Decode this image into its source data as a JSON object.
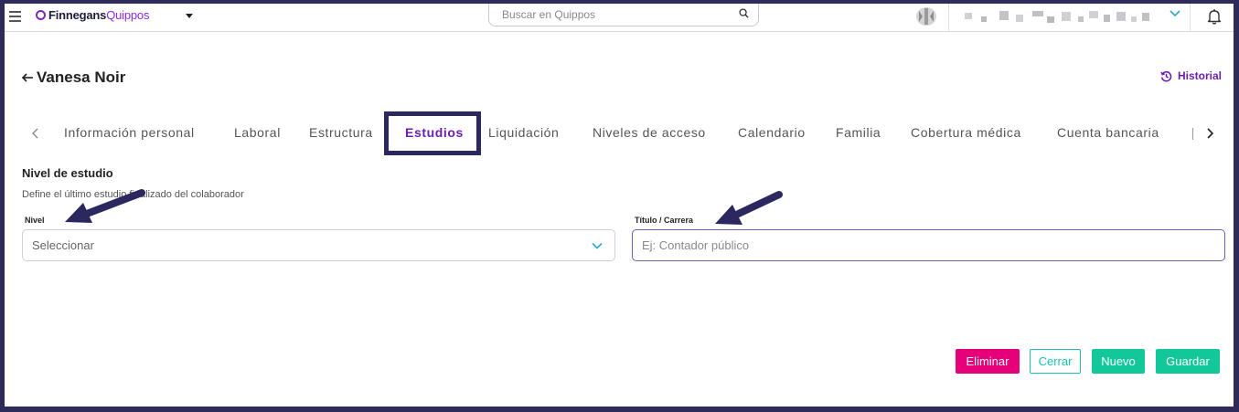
{
  "header": {
    "brand_part1": "Finnegans",
    "brand_part2": "Quippos",
    "search_placeholder": "Buscar en Quippos"
  },
  "page": {
    "person_name": "Vanesa Noir",
    "history_label": "Historial"
  },
  "tabs": [
    {
      "label": "Información personal",
      "active": false
    },
    {
      "label": "Laboral",
      "active": false
    },
    {
      "label": "Estructura",
      "active": false
    },
    {
      "label": "Estudios",
      "active": true
    },
    {
      "label": "Liquidación",
      "active": false
    },
    {
      "label": "Niveles de acceso",
      "active": false
    },
    {
      "label": "Calendario",
      "active": false
    },
    {
      "label": "Familia",
      "active": false
    },
    {
      "label": "Cobertura médica",
      "active": false
    },
    {
      "label": "Cuenta bancaria",
      "active": false
    }
  ],
  "form": {
    "section_title": "Nivel de estudio",
    "section_description": "Define el último estudio finalizado del colaborador",
    "nivel": {
      "label": "Nivel",
      "value": "Seleccionar"
    },
    "titulo": {
      "label": "Título / Carrera",
      "value": "",
      "placeholder": "Ej: Contador público"
    }
  },
  "actions": {
    "delete_label": "Eliminar",
    "close_label": "Cerrar",
    "new_label": "Nuevo",
    "save_label": "Guardar"
  },
  "colors": {
    "brand_purple": "#6b1fb0",
    "active_tab_frame": "#2b2860",
    "delete": "#e6007a",
    "primary_green": "#12c79a",
    "outline_teal": "#19c3b0",
    "annotation_arrow": "#2b2860"
  }
}
